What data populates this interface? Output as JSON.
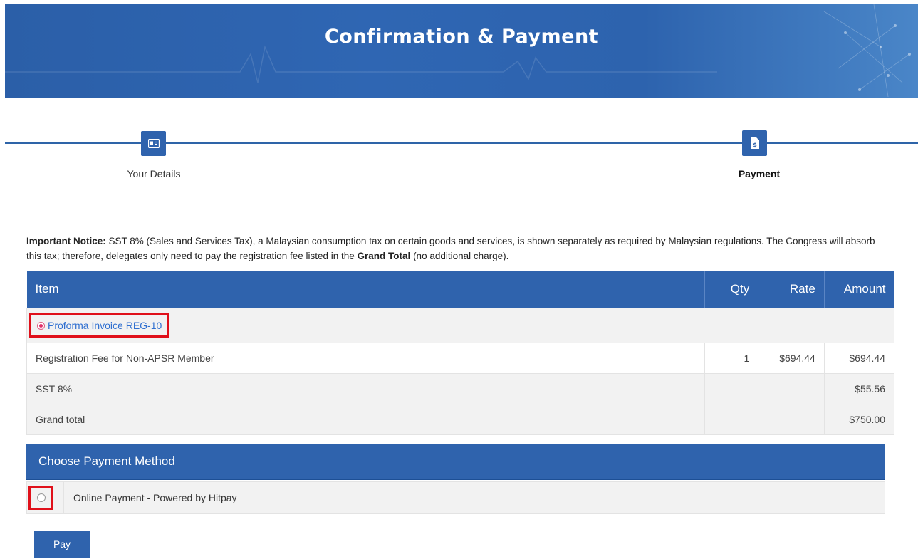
{
  "header": {
    "title": "Confirmation & Payment"
  },
  "stepper": {
    "steps": [
      {
        "label": "Your Details",
        "icon": "id-card-icon"
      },
      {
        "label": "Payment",
        "icon": "invoice-dollar-icon"
      }
    ]
  },
  "notice": {
    "label": "Important Notice:",
    "text_1": " SST 8% (Sales and Services Tax), a Malaysian consumption tax on certain goods and services, is shown separately as required by Malaysian regulations. The Congress will absorb this tax; therefore, delegates only need to pay the registration fee listed in the ",
    "bold": "Grand Total",
    "text_2": " (no additional charge)."
  },
  "invoice_table": {
    "headers": {
      "item": "Item",
      "qty": "Qty",
      "rate": "Rate",
      "amount": "Amount"
    },
    "proforma_label": "Proforma Invoice REG-10",
    "rows": [
      {
        "item": "Registration Fee for Non-APSR Member",
        "qty": "1",
        "rate": "$694.44",
        "amount": "$694.44"
      },
      {
        "item": "SST 8%",
        "qty": "",
        "rate": "",
        "amount": "$55.56"
      },
      {
        "item": "Grand total",
        "qty": "",
        "rate": "",
        "amount": "$750.00"
      }
    ]
  },
  "payment": {
    "heading": "Choose Payment Method",
    "option_label": "Online Payment - Powered by Hitpay",
    "pay_button": "Pay"
  },
  "colors": {
    "primary": "#2f63ad",
    "highlight": "#e0101a",
    "link": "#2f6fd0"
  }
}
